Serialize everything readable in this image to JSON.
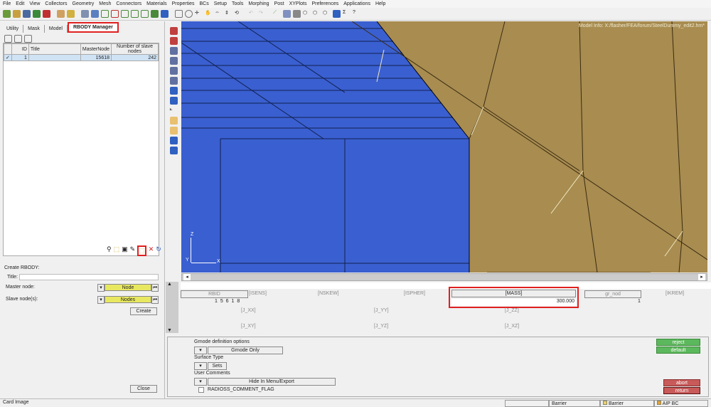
{
  "menu": [
    "File",
    "Edit",
    "View",
    "Collectors",
    "Geometry",
    "Mesh",
    "Connectors",
    "Materials",
    "Properties",
    "BCs",
    "Setup",
    "Tools",
    "Morphing",
    "Post",
    "XYPlots",
    "Preferences",
    "Applications",
    "Help"
  ],
  "tabs": [
    "Utility",
    "Mask",
    "Model",
    "RBODY Manager"
  ],
  "table": {
    "headers": [
      "ID",
      "Title",
      "MasterNode",
      "Number of slave nodes"
    ],
    "rows": [
      {
        "id": "1",
        "title": "",
        "master": "15618",
        "slaves": "242"
      }
    ]
  },
  "create": {
    "heading": "Create RBODY:",
    "title_label": "Title:",
    "title_value": "",
    "master_label": "Master node:",
    "master_btn": "Node",
    "slave_label": "Slave node(s):",
    "slave_btn": "Nodes",
    "create_btn": "Create",
    "close_btn": "Close"
  },
  "viewport": {
    "model_info": "Model Info: X:/flasher/FEA/forum/SteelDummy_edit2.hm*",
    "axes": [
      "Z",
      "Y",
      "X"
    ],
    "colors": {
      "blue": "#3a5fd0",
      "tan": "#a88c50"
    }
  },
  "card": {
    "rbid": "RBID",
    "rbid_val": "1 5 6 1 8",
    "isens": "[ISENS]",
    "nskew": "[NSKEW]",
    "ispher": "[ISPHER]",
    "mass": "[MASS]",
    "mass_val": "300.000",
    "gr_nod": "gr_nod",
    "gr_nod_val": "1",
    "ikrem": "[IKREM]",
    "jxx": "[J_XX]",
    "jyy": "[J_YY]",
    "jzz": "[J_ZZ]",
    "jxy": "[J_XY]",
    "jyz": "[J_YZ]",
    "jxz": "[J_XZ]"
  },
  "options": {
    "grnod_label": "Grnode definition options",
    "grnod_value": "Grnode Only",
    "surf_label": "Surface Type",
    "surf_value": "Sets",
    "comments_label": "User Comments",
    "comments_value": "Hide In Menu/Export",
    "flag_label": "RADIOSS_COMMENT_FLAG"
  },
  "actions": {
    "reject": "reject",
    "default": "default",
    "abort": "abort",
    "return": "return"
  },
  "status": {
    "left": "Card Image",
    "s1": "",
    "s2": "Barrier",
    "s3": "Barrier",
    "s4": "AIP BC"
  }
}
